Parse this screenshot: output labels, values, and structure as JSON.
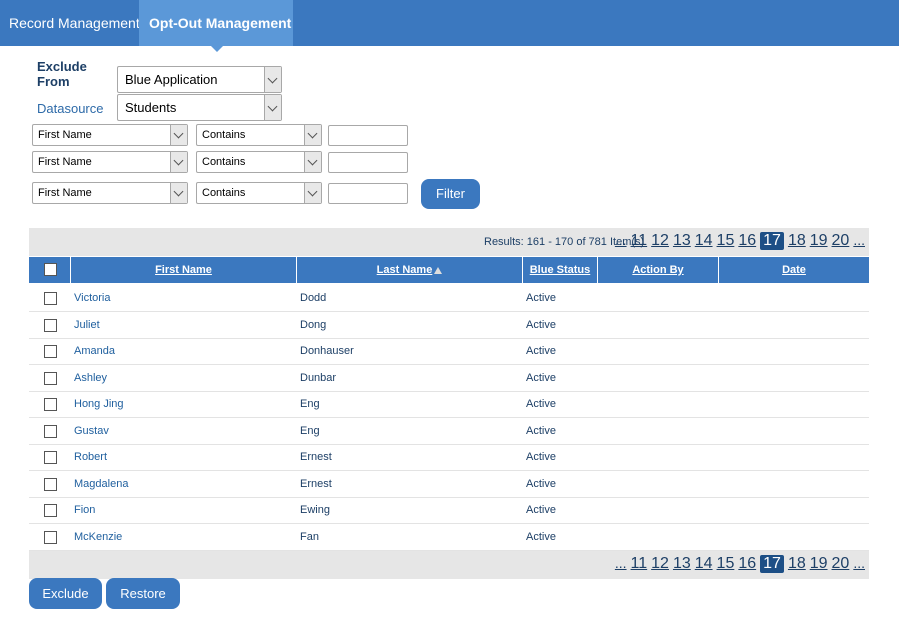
{
  "nav": {
    "tabs": [
      {
        "label": "Record Management"
      },
      {
        "label": "Opt-Out Management"
      }
    ]
  },
  "filters": {
    "exclude_from_label": "Exclude From",
    "exclude_from_value": "Blue Application",
    "datasource_label": "Datasource",
    "datasource_value": "Students",
    "rows": [
      {
        "field": "First Name",
        "operator": "Contains",
        "value": ""
      },
      {
        "field": "First Name",
        "operator": "Contains",
        "value": ""
      },
      {
        "field": "First Name",
        "operator": "Contains",
        "value": ""
      }
    ],
    "filter_button": "Filter"
  },
  "grid": {
    "results_text": "Results: 161 - 170 of 781 Item(s)",
    "pages": [
      "...",
      "11",
      "12",
      "13",
      "14",
      "15",
      "16",
      "17",
      "18",
      "19",
      "20",
      "..."
    ],
    "current_page": "17",
    "columns": [
      "First Name",
      "Last Name",
      "Blue Status",
      "Action By",
      "Date"
    ],
    "sorted_column": "Last Name",
    "rows": [
      {
        "first": "Victoria",
        "last": "Dodd",
        "status": "Active",
        "action_by": "",
        "date": ""
      },
      {
        "first": "Juliet",
        "last": "Dong",
        "status": "Active",
        "action_by": "",
        "date": ""
      },
      {
        "first": "Amanda",
        "last": "Donhauser",
        "status": "Active",
        "action_by": "",
        "date": ""
      },
      {
        "first": "Ashley",
        "last": "Dunbar",
        "status": "Active",
        "action_by": "",
        "date": ""
      },
      {
        "first": "Hong Jing",
        "last": "Eng",
        "status": "Active",
        "action_by": "",
        "date": ""
      },
      {
        "first": "Gustav",
        "last": "Eng",
        "status": "Active",
        "action_by": "",
        "date": ""
      },
      {
        "first": "Robert",
        "last": "Ernest",
        "status": "Active",
        "action_by": "",
        "date": ""
      },
      {
        "first": "Magdalena",
        "last": "Ernest",
        "status": "Active",
        "action_by": "",
        "date": ""
      },
      {
        "first": "Fion",
        "last": "Ewing",
        "status": "Active",
        "action_by": "",
        "date": ""
      },
      {
        "first": "McKenzie",
        "last": "Fan",
        "status": "Active",
        "action_by": "",
        "date": ""
      }
    ]
  },
  "actions": {
    "exclude": "Exclude",
    "restore": "Restore"
  },
  "colors": {
    "primary": "#3b78bf",
    "active_tab": "#5b98d8",
    "current_page": "#1d4f86"
  }
}
